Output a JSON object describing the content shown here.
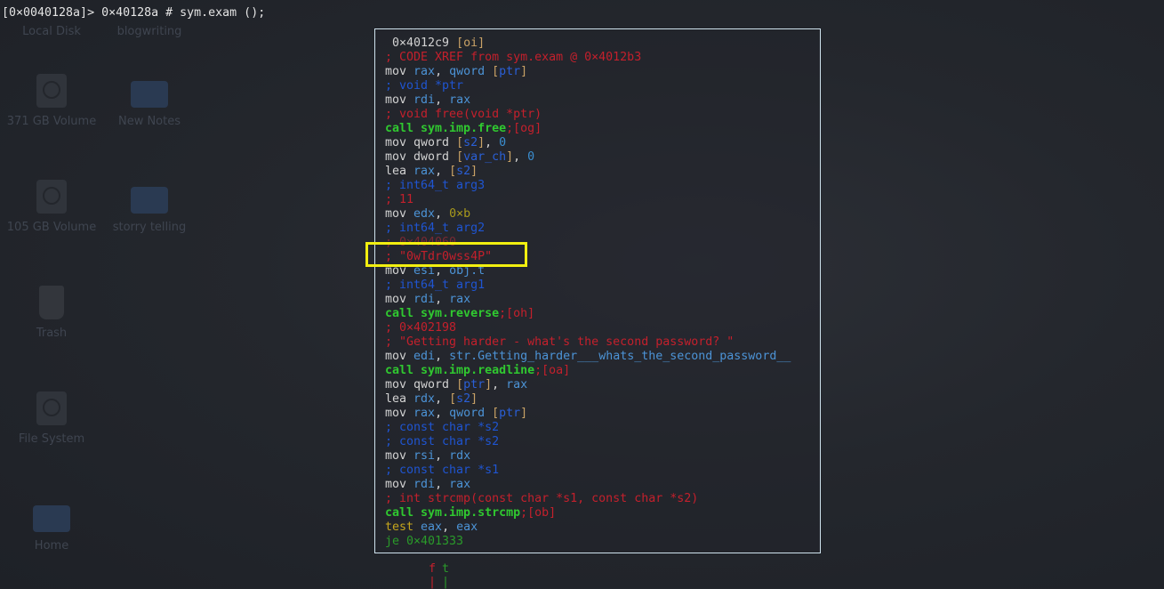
{
  "prompt": "[0×0040128a]> 0×40128a # sym.exam ();",
  "desktop": [
    {
      "label": "Local Disk",
      "icon": "disk"
    },
    {
      "label": "blogwriting",
      "icon": "folder"
    },
    {
      "label": "371 GB Volume",
      "icon": "disk"
    },
    {
      "label": "New Notes",
      "icon": "folder"
    },
    {
      "label": "105 GB Volume",
      "icon": "disk"
    },
    {
      "label": "storry telling",
      "icon": "folder"
    },
    {
      "label": "Trash",
      "icon": "trash"
    },
    {
      "label": "File System",
      "icon": "disk"
    },
    {
      "label": "Home",
      "icon": "folder"
    }
  ],
  "colors": {
    "panel_border": "#cfe3ee",
    "highlight": "#f2ef10",
    "comment_red": "#c4202c",
    "call_green": "#30c830"
  },
  "lines": [
    [
      [
        " 0×4012c9 ",
        "w"
      ],
      [
        "[oi]",
        "b"
      ]
    ],
    [
      [
        "; CODE XREF from sym.exam @ 0×4012b3",
        "cr"
      ]
    ],
    [
      [
        "mov ",
        "w"
      ],
      [
        "rax",
        "r"
      ],
      [
        ", ",
        "w"
      ],
      [
        "qword ",
        "r"
      ],
      [
        "[",
        "b"
      ],
      [
        "ptr",
        "v"
      ],
      [
        "]",
        "b"
      ]
    ],
    [
      [
        "; void *ptr",
        "cb"
      ]
    ],
    [
      [
        "mov ",
        "w"
      ],
      [
        "rdi",
        "r"
      ],
      [
        ", ",
        "w"
      ],
      [
        "rax",
        "r"
      ]
    ],
    [
      [
        "; void free(void *ptr)",
        "cr"
      ]
    ],
    [
      [
        "call sym.imp.free",
        "g"
      ],
      [
        ";[og]",
        "cr"
      ]
    ],
    [
      [
        "mov ",
        "w"
      ],
      [
        "qword ",
        "w"
      ],
      [
        "[",
        "b"
      ],
      [
        "s2",
        "v"
      ],
      [
        "]",
        "b"
      ],
      [
        ", ",
        "w"
      ],
      [
        "0",
        "n"
      ]
    ],
    [
      [
        "mov ",
        "w"
      ],
      [
        "dword ",
        "w"
      ],
      [
        "[",
        "b"
      ],
      [
        "var_ch",
        "v"
      ],
      [
        "]",
        "b"
      ],
      [
        ", ",
        "w"
      ],
      [
        "0",
        "n"
      ]
    ],
    [
      [
        "lea ",
        "w"
      ],
      [
        "rax",
        "r"
      ],
      [
        ", ",
        "w"
      ],
      [
        "[",
        "b"
      ],
      [
        "s2",
        "v"
      ],
      [
        "]",
        "b"
      ]
    ],
    [
      [
        "; int64_t arg3",
        "cb"
      ]
    ],
    [
      [
        "; 11",
        "cr"
      ]
    ],
    [
      [
        "mov ",
        "w"
      ],
      [
        "edx",
        "r"
      ],
      [
        ", ",
        "w"
      ],
      [
        "0×b",
        "y"
      ]
    ],
    [
      [
        "; int64_t arg2",
        "cb"
      ]
    ],
    [
      [
        "; 0×404060",
        "dim"
      ]
    ],
    [
      [
        "; \"0wTdr0wss4P\"",
        "cr"
      ]
    ],
    [
      [
        "mov ",
        "w"
      ],
      [
        "esi",
        "r"
      ],
      [
        ", ",
        "w"
      ],
      [
        "obj.t",
        "r"
      ]
    ],
    [
      [
        "; int64_t arg1",
        "cb"
      ]
    ],
    [
      [
        "mov ",
        "w"
      ],
      [
        "rdi",
        "r"
      ],
      [
        ", ",
        "w"
      ],
      [
        "rax",
        "r"
      ]
    ],
    [
      [
        "call sym.reverse",
        "g"
      ],
      [
        ";[oh]",
        "cr"
      ]
    ],
    [
      [
        "; 0×402198",
        "cr"
      ]
    ],
    [
      [
        "; \"Getting harder - what's the second password? \"",
        "cr"
      ]
    ],
    [
      [
        "mov ",
        "w"
      ],
      [
        "edi",
        "r"
      ],
      [
        ", ",
        "w"
      ],
      [
        "str.Getting_harder___whats_the_second_password__",
        "r"
      ]
    ],
    [
      [
        "call sym.imp.readline",
        "g"
      ],
      [
        ";[oa]",
        "cr"
      ]
    ],
    [
      [
        "mov ",
        "w"
      ],
      [
        "qword ",
        "w"
      ],
      [
        "[",
        "b"
      ],
      [
        "ptr",
        "v"
      ],
      [
        "]",
        "b"
      ],
      [
        ", ",
        "w"
      ],
      [
        "rax",
        "r"
      ]
    ],
    [
      [
        "lea ",
        "w"
      ],
      [
        "rdx",
        "r"
      ],
      [
        ", ",
        "w"
      ],
      [
        "[",
        "b"
      ],
      [
        "s2",
        "v"
      ],
      [
        "]",
        "b"
      ]
    ],
    [
      [
        "mov ",
        "w"
      ],
      [
        "rax",
        "r"
      ],
      [
        ", ",
        "w"
      ],
      [
        "qword ",
        "r"
      ],
      [
        "[",
        "b"
      ],
      [
        "ptr",
        "v"
      ],
      [
        "]",
        "b"
      ]
    ],
    [
      [
        "; const char *s2",
        "cb"
      ]
    ],
    [
      [
        "; const char *s2",
        "cb"
      ]
    ],
    [
      [
        "mov ",
        "w"
      ],
      [
        "rsi",
        "r"
      ],
      [
        ", ",
        "w"
      ],
      [
        "rdx",
        "r"
      ]
    ],
    [
      [
        "; const char *s1",
        "cb"
      ]
    ],
    [
      [
        "mov ",
        "w"
      ],
      [
        "rdi",
        "r"
      ],
      [
        ", ",
        "w"
      ],
      [
        "rax",
        "r"
      ]
    ],
    [
      [
        "; int strcmp(const char *s1, const char *s2)",
        "cr"
      ]
    ],
    [
      [
        "call sym.imp.strcmp",
        "g"
      ],
      [
        ";[ob]",
        "cr"
      ]
    ],
    [
      [
        "test ",
        "t"
      ],
      [
        "eax",
        "r"
      ],
      [
        ", ",
        "w"
      ],
      [
        "eax",
        "r"
      ]
    ],
    [
      [
        "je 0×401333",
        "j"
      ]
    ]
  ],
  "branches": {
    "false_label": "f",
    "true_label": "t",
    "edge": "|"
  }
}
